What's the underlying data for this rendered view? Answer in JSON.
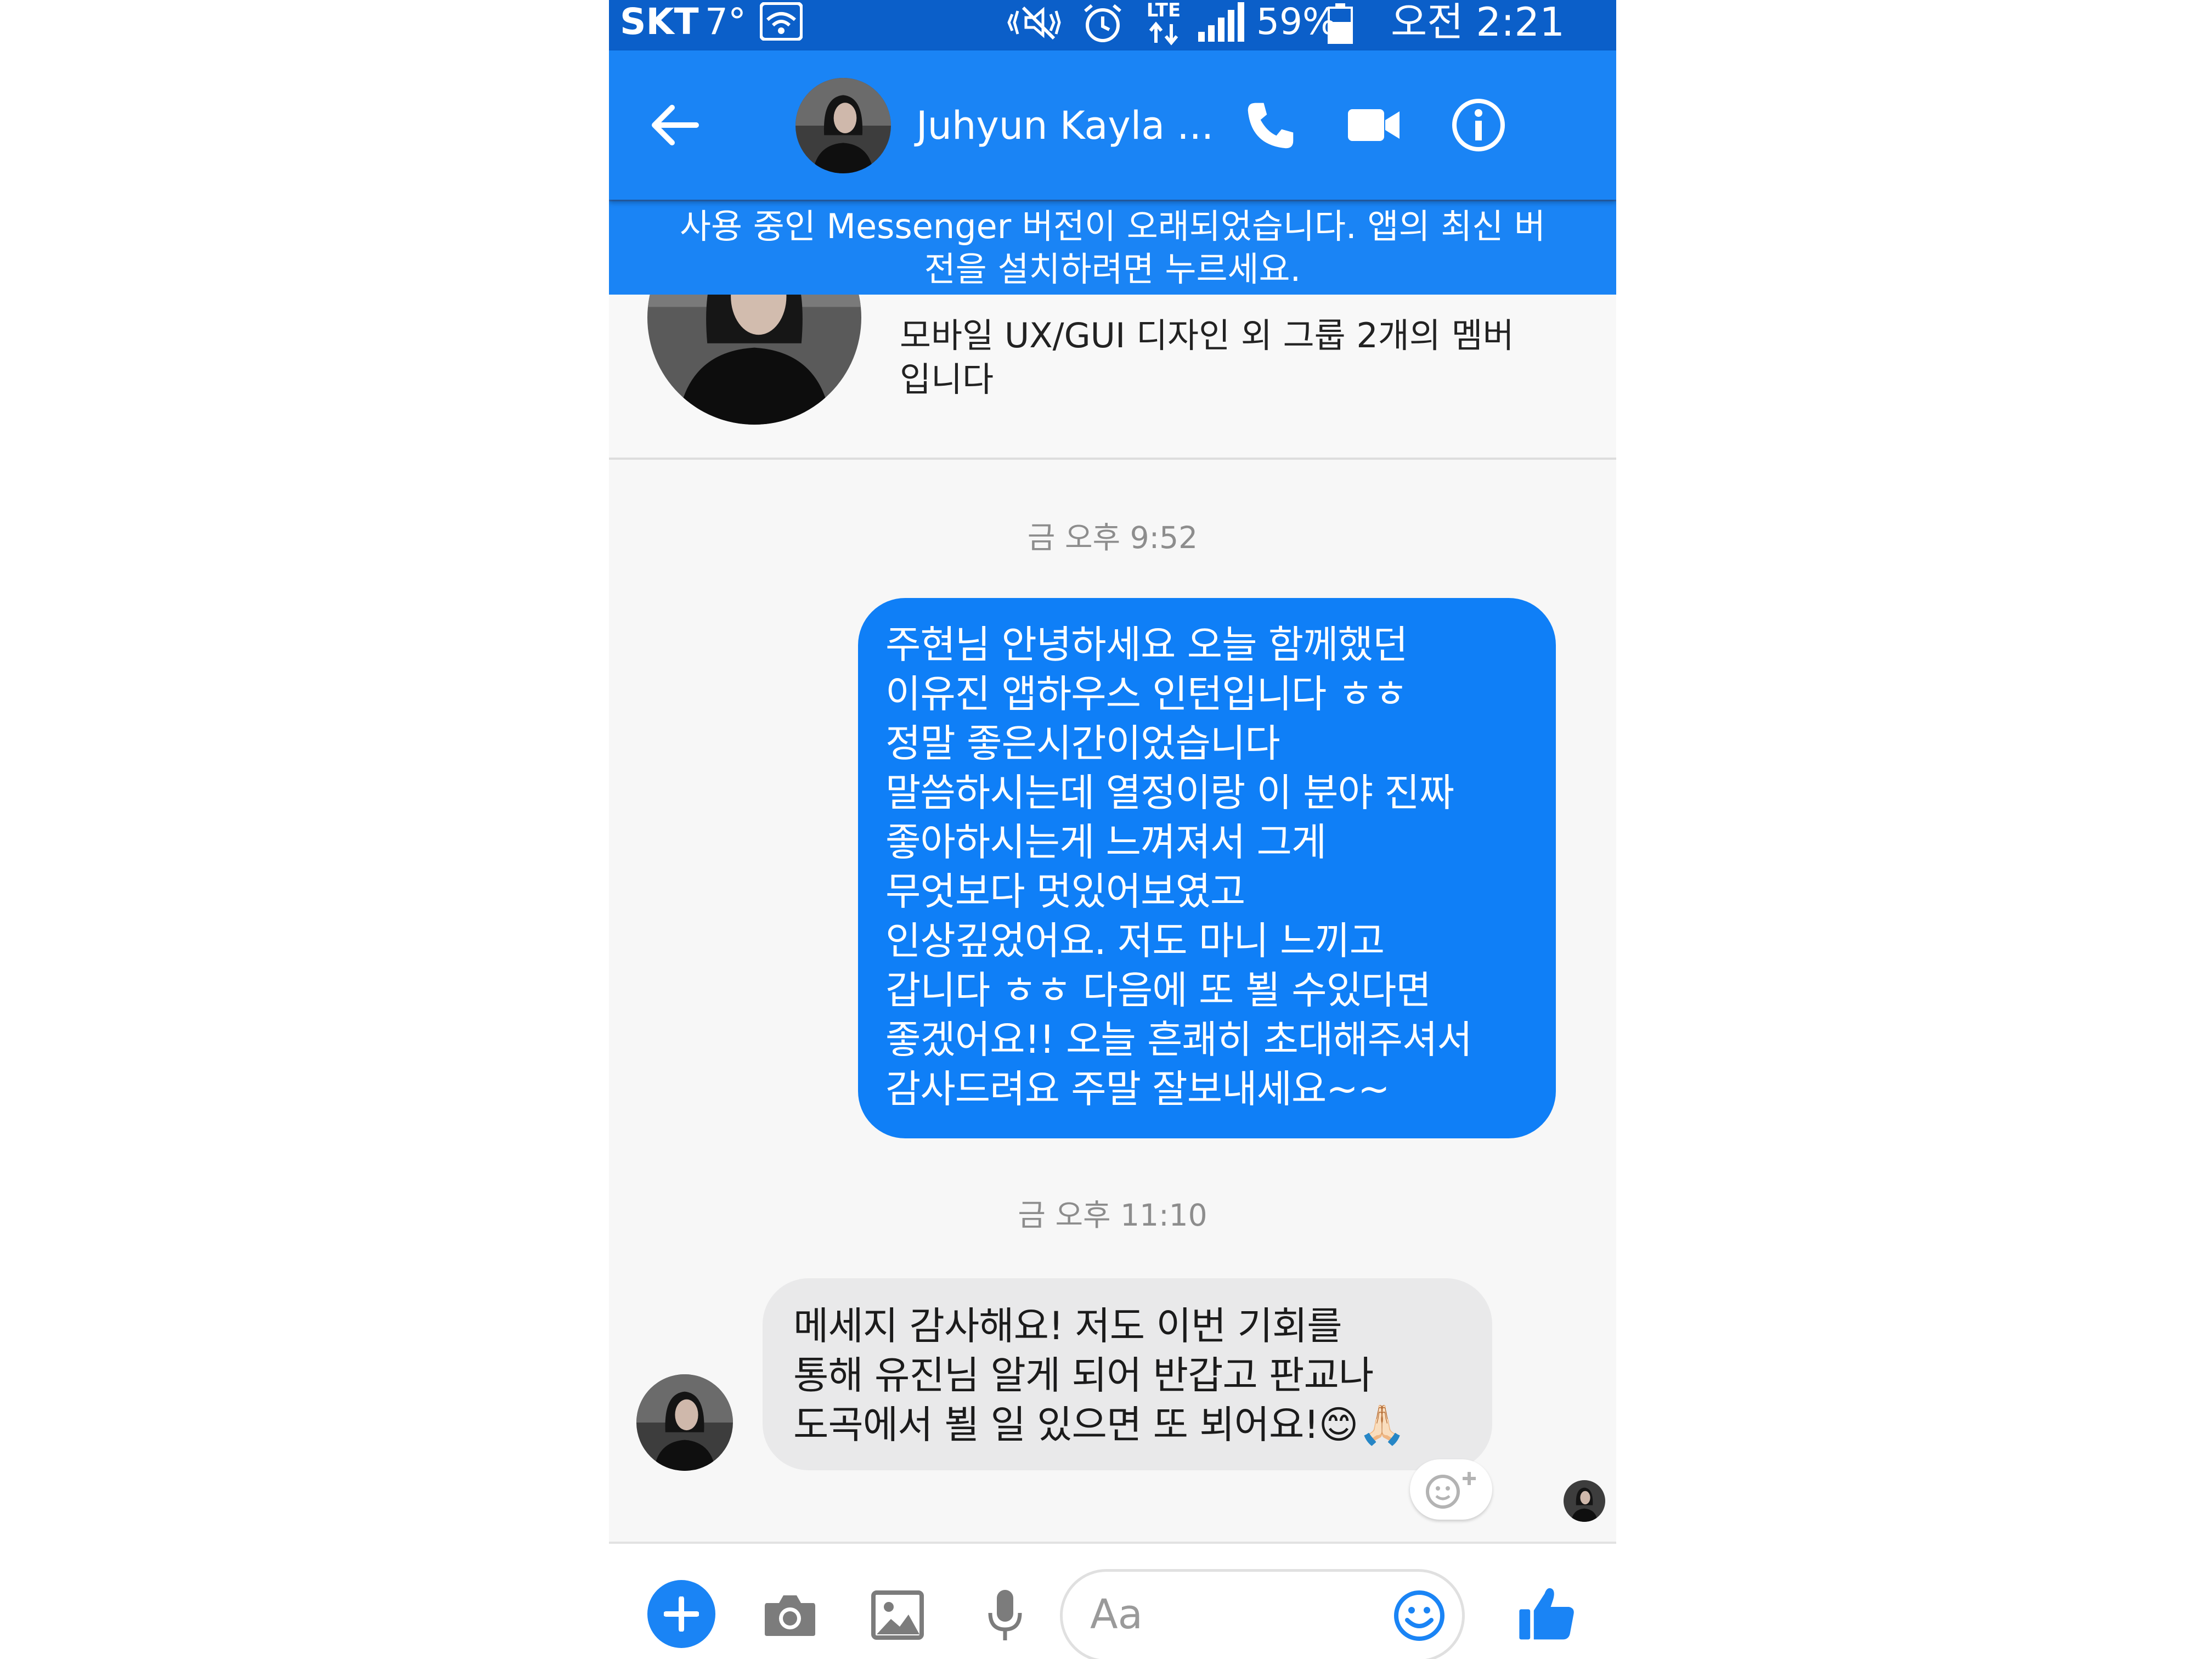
{
  "status_bar": {
    "carrier": "SKT",
    "temperature": "7°",
    "network": "LTE",
    "battery": "59%",
    "time": "오전 2:21",
    "icons": [
      "wifi-icon",
      "mute-vibrate-icon",
      "alarm-icon",
      "lte-data-icon",
      "signal-icon",
      "battery-icon"
    ]
  },
  "header": {
    "contact_name": "Juhyun Kayla ...",
    "icons": [
      "back-arrow-icon",
      "phone-icon",
      "video-camera-icon",
      "info-icon"
    ]
  },
  "update_banner": {
    "text": "사용 중인 Messenger 버전이 오래되었습니다. 앱의 최신 버전을 설치하려면 누르세요."
  },
  "profile": {
    "groups_text": "모바일 UX/GUI 디자인 외 그룹 2개의 멤버입니다"
  },
  "messages": [
    {
      "timestamp": "금 오후 9:52",
      "direction": "outgoing",
      "text": "주현님 안녕하세요 오늘 함께했던\n이유진 앱하우스 인턴입니다 ㅎㅎ\n정말 좋은시간이었습니다\n말씀하시는데 열정이랑 이 분야 진짜\n좋아하시는게 느껴져서 그게\n무엇보다 멋있어보였고\n인상깊었어요. 저도 마니 느끼고\n갑니다 ㅎㅎ 다음에 또 뵐 수있다면\n좋겠어요!! 오늘 흔쾌히 초대해주셔서\n감사드려요 주말 잘보내세요~~"
    },
    {
      "timestamp": "금 오후 11:10",
      "direction": "incoming",
      "text": "메세지 감사해요! 저도 이번 기회를\n통해 유진님 알게 되어 반갑고 판교나\n도곡에서 뵐 일 있으면 또 뵈어요!😊🙏🏻"
    }
  ],
  "composer": {
    "placeholder": "Aa",
    "icons": [
      "plus-icon",
      "camera-icon",
      "image-icon",
      "microphone-icon",
      "emoji-icon",
      "thumbs-up-icon"
    ]
  },
  "colors": {
    "status_bar": "#0b5fc9",
    "header": "#1a84f5",
    "outgoing_bubble": "#0f7ff7",
    "incoming_bubble": "#e9e9ea",
    "timestamp": "#8d8d8d"
  }
}
